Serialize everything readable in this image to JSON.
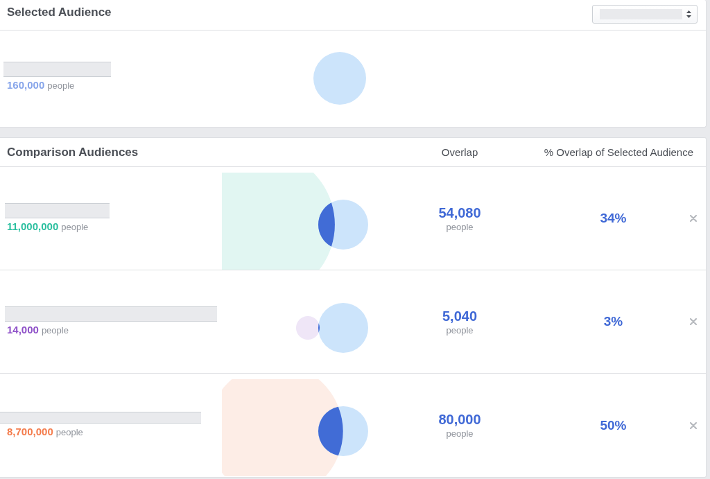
{
  "selected_audience": {
    "title": "Selected Audience",
    "count": "160,000",
    "unit": "people",
    "color": "#87a5ea"
  },
  "comparison": {
    "title": "Comparison Audiences",
    "columns": [
      "Overlap",
      "% Overlap of Selected Audience"
    ],
    "rows": [
      {
        "count": "11,000,000",
        "unit": "people",
        "color": "#2bbf9f",
        "overlap": "54,080",
        "overlap_unit": "people",
        "percent": "34%"
      },
      {
        "count": "14,000",
        "unit": "people",
        "color": "#8e50c8",
        "overlap": "5,040",
        "overlap_unit": "people",
        "percent": "3%"
      },
      {
        "count": "8,700,000",
        "unit": "people",
        "color": "#f47b4b",
        "overlap": "80,000",
        "overlap_unit": "people",
        "percent": "50%"
      }
    ]
  }
}
